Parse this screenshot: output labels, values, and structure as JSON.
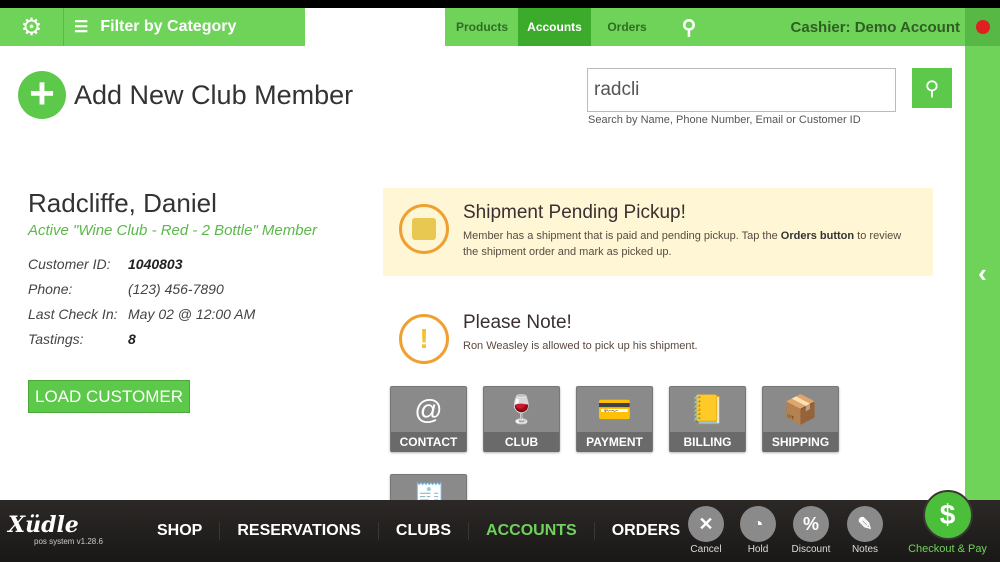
{
  "topbar": {
    "filter_label": "Filter by Category",
    "tabs": [
      {
        "label": "Products",
        "active": false
      },
      {
        "label": "Accounts",
        "active": true
      },
      {
        "label": "Orders",
        "active": false
      }
    ],
    "cashier": "Cashier: Demo Account"
  },
  "main": {
    "add_member": "Add New Club Member",
    "search": {
      "value": "radcli",
      "hint": "Search by Name, Phone Number, Email or Customer ID"
    }
  },
  "customer": {
    "name": "Radcliffe, Daniel",
    "membership": "Active \"Wine Club - Red - 2 Bottle\" Member",
    "fields": [
      {
        "label": "Customer ID:",
        "value": "1040803"
      },
      {
        "label": "Phone:",
        "value": "(123) 456-7890"
      },
      {
        "label": "Last Check In:",
        "value": "May 02 @ 12:00 AM"
      },
      {
        "label": "Tastings:",
        "value": "8"
      }
    ],
    "load_button": "LOAD CUSTOMER"
  },
  "alerts": {
    "shipment": {
      "title": "Shipment Pending Pickup!",
      "text_before": "Member has a shipment that is paid and pending pickup. Tap the ",
      "text_bold": "Orders button",
      "text_after": " to review the shipment order and mark as picked up."
    },
    "note": {
      "title": "Please Note!",
      "text": "Ron Weasley is allowed to pick up his shipment."
    }
  },
  "tiles": [
    {
      "label": "CONTACT",
      "icon": "at-icon",
      "glyph": "@"
    },
    {
      "label": "CLUB",
      "icon": "wine-glasses-icon",
      "glyph": "🍷"
    },
    {
      "label": "PAYMENT",
      "icon": "credit-card-icon",
      "glyph": "💳"
    },
    {
      "label": "BILLING",
      "icon": "address-book-icon",
      "glyph": "📒"
    },
    {
      "label": "SHIPPING",
      "icon": "box-icon",
      "glyph": "📦"
    }
  ],
  "bottom": {
    "logo": "Xudle",
    "version": "pos system v1.28.6",
    "nav": [
      "SHOP",
      "RESERVATIONS",
      "CLUBS",
      "ACCOUNTS",
      "ORDERS"
    ],
    "active_nav": "ACCOUNTS",
    "actions": [
      {
        "label": "Cancel",
        "glyph": "✕"
      },
      {
        "label": "Hold",
        "glyph": "◔"
      },
      {
        "label": "Discount",
        "glyph": "%"
      },
      {
        "label": "Notes",
        "glyph": "✎"
      }
    ],
    "checkout": "Checkout & Pay"
  },
  "colors": {
    "brand_green": "#6fd35a",
    "active_green": "#3caa2a",
    "alert_bg": "#fff6d5",
    "alert_ring": "#f0a030"
  }
}
